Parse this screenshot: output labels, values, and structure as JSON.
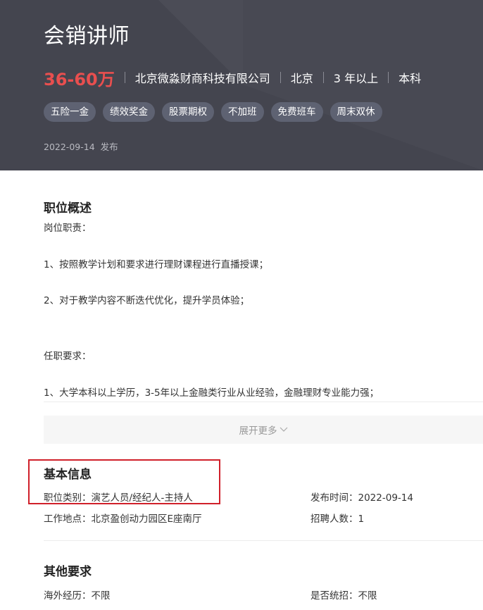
{
  "job": {
    "title": "会销讲师",
    "salary": "36-60万",
    "company": "北京微淼财商科技有限公司",
    "city": "北京",
    "experience": "3 年以上",
    "education": "本科",
    "tags": [
      "五险一金",
      "绩效奖金",
      "股票期权",
      "不加班",
      "免费班车",
      "周末双休"
    ],
    "publish_date": "2022-09-14",
    "publish_suffix": "发布"
  },
  "overview": {
    "title": "职位概述",
    "lines": [
      "岗位职责：",
      "1、按照教学计划和要求进行理财课程进行直播授课；",
      "2、对于教学内容不断迭代优化，提升学员体验；",
      "任职要求：",
      "1、大学本科以上学历，3-5年以上金融类行业从业经验，金融理财专业能力强；"
    ],
    "expand_label": "展开更多"
  },
  "basic_info": {
    "title": "基本信息",
    "category": "职位类别：演艺人员/经纪人-主持人",
    "location": "工作地点：北京盈创动力园区E座南厅",
    "publish_time": "发布时间：2022-09-14",
    "headcount": "招聘人数：1"
  },
  "other": {
    "title": "其他要求",
    "overseas": "海外经历：不限",
    "campus": "是否统招：不限"
  },
  "colors": {
    "header_bg": "#44454f",
    "salary": "#e94f4f",
    "tag_bg": "#5e6272",
    "highlight": "#d0202a"
  }
}
